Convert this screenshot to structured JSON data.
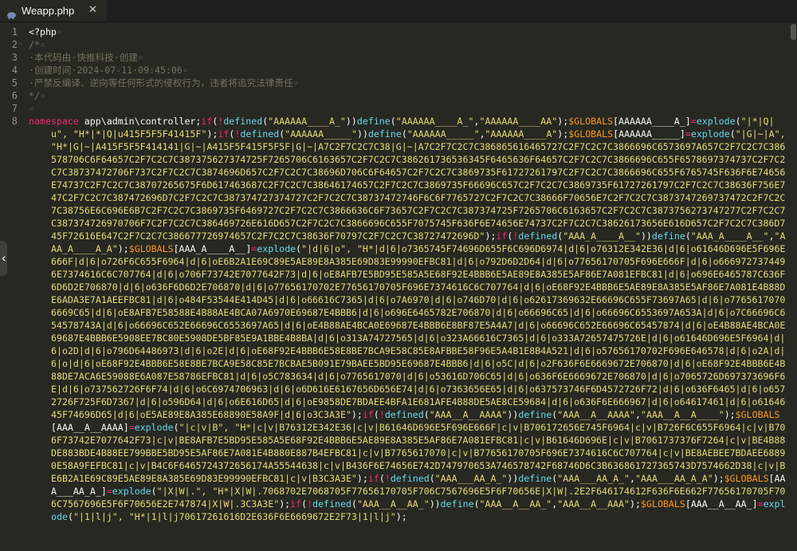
{
  "tab": {
    "title": "Weapp.php",
    "close": "✕",
    "icon": "elephant-icon"
  },
  "gutter": [
    {
      "n": "1",
      "fold": ""
    },
    {
      "n": "2",
      "fold": "-"
    },
    {
      "n": "3",
      "fold": ""
    },
    {
      "n": "4",
      "fold": ""
    },
    {
      "n": "5",
      "fold": ""
    },
    {
      "n": "6",
      "fold": ""
    },
    {
      "n": "7",
      "fold": ""
    },
    {
      "n": "8",
      "fold": ""
    }
  ],
  "code": {
    "l1": "<?php",
    "l2": "/*",
    "l3": "·本代码由·快推科技·创建",
    "l4": "·创建时间·2024-07-11·09:45:06",
    "l5": "·严禁反编译、逆向等任何形式的侵权行为，违者将追究法律责任",
    "l6": "*/",
    "l7": "",
    "l8": [
      [
        "kw",
        "namespace"
      ],
      [
        "ns",
        " app\\admin\\controller;"
      ],
      [
        "kw",
        "if"
      ],
      [
        "ns",
        "("
      ],
      [
        "op",
        "!"
      ],
      [
        "fn",
        "defined"
      ],
      [
        "ns",
        "("
      ],
      [
        "str",
        "\"AAAAAA____A_\""
      ],
      [
        "ns",
        "))"
      ],
      [
        "fn",
        "define"
      ],
      [
        "ns",
        "("
      ],
      [
        "str",
        "\"AAAAAA____A_\""
      ],
      [
        "ns",
        ","
      ],
      [
        "str",
        "\"AAAAAA____AA\""
      ],
      [
        "ns",
        ");"
      ],
      [
        "var",
        "$GLOBALS"
      ],
      [
        "ns",
        "[AAAAAA____A_]"
      ],
      [
        "op",
        "="
      ],
      [
        "fn",
        "explode"
      ],
      [
        "ns",
        "("
      ],
      [
        "str",
        "\"|*|Q|u\", \"H*|*|Q|u415F5F5F41415F\""
      ],
      [
        "ns",
        ");"
      ],
      [
        "kw",
        "if"
      ],
      [
        "ns",
        "("
      ],
      [
        "op",
        "!"
      ],
      [
        "fn",
        "defined"
      ],
      [
        "ns",
        "("
      ],
      [
        "str",
        "\"AAAAAA_____\""
      ],
      [
        "ns",
        "))"
      ],
      [
        "fn",
        "define"
      ],
      [
        "ns",
        "("
      ],
      [
        "str",
        "\"AAAAAA_____\""
      ],
      [
        "ns",
        ","
      ],
      [
        "str",
        "\"AAAAAA____A\""
      ],
      [
        "ns",
        ");"
      ],
      [
        "var",
        "$GLOBALS"
      ],
      [
        "ns",
        "[AAAAAA_____]"
      ],
      [
        "op",
        "="
      ],
      [
        "fn",
        "explode"
      ],
      [
        "ns",
        "("
      ],
      [
        "str",
        "\"|G|~|A\", \"H*|G|~|A415F5F5F414141|G|~|A415F5F415F5F5F|G|~|A7C2F7C2C7C38|G|~|A7C2F7C2C7C386865616465727C2F7C2C7C3866696C6573697A657C2F7C2C7C386578706C6F64657C2F7C2C7C387375627374725F7265706C6163657C2F7C2C7C386261736536345F6465636F64657C2F7C2C7C3866696C655F6578697374737C2F7C2C7C38737472706F737C2F7C2C7C3874696D657C2F7C2C7C38696D706C6F64657C2F7C2C7C3869735F61727261797C2F7C2C7C3866696C655F6765745F636F6E74656E74737C2F7C2C7C38707265675F6D617463687C2F7C2C7C38646174657C2F7C2C7C3869735F66696C657C2F7C2C7C3869735F61727261797C2F7C2C7C38636F756E747C2F7C2C7C387472696D7C2F7C2C7C387374727374727C2F7C2C7C38737472746F6C6F7765727C2F7C2C7C38666F70656E7C2F7C2C7C3873747269737472C2F7C2C7C38756E6C696E6B7C2F7C2C7C3869735F6469727C2F7C2C7C3866636C6F73657C2F7C2C7C387374725F7265706C6163657C2F7C2C7C3873756273747277C2F7C2C7C387374726970706F7C2F7C2C7C386469726E616D657C2F7C2C7C3866696C655F7075745F636F6E74656E74737C2F7C2C7C38626173656E616D657C2F7C2C7C386D745F72616E647C2F7C2C7C386677726974657C2F7C2C7C38636F70797C2F7C2C7C38727472696D\""
      ],
      [
        "ns",
        ");"
      ],
      [
        "kw",
        "if"
      ],
      [
        "ns",
        "("
      ],
      [
        "op",
        "!"
      ],
      [
        "fn",
        "defined"
      ],
      [
        "ns",
        "("
      ],
      [
        "str",
        "\"AAA_A____A__\""
      ],
      [
        "ns",
        "))"
      ],
      [
        "fn",
        "define"
      ],
      [
        "ns",
        "("
      ],
      [
        "str",
        "\"AAA_A____A__\""
      ],
      [
        "ns",
        ","
      ],
      [
        "str",
        "\"AAA_A____A_A\""
      ],
      [
        "ns",
        ");"
      ],
      [
        "var",
        "$GLOBALS"
      ],
      [
        "ns",
        "[AAA_A____A__]"
      ],
      [
        "op",
        "="
      ],
      [
        "fn",
        "explode"
      ],
      [
        "ns",
        "("
      ],
      [
        "str",
        "\"|d|6|o\", \"H*|d|6|o7365745F74696D655F6C696D6974|d|6|o76312E342E36|d|6|o61646D696E5F696E666F|d|6|o726F6C655F6964|d|6|oE6B2A1E69C89E5AE89E8A385E69D83E99990EFBC81|d|6|o792D6D2D64|d|6|o77656170705F696E666F|d|6|o6669727374496E7374616C6C707764|d|6|o706F73742E7077642F73|d|6|oE8AFB7E5BD95E585A5E68F92E4BBB6E5AE89E8A385E5AF86E7A081EFBC81|d|6|o696E6465787C636F6D6D2E706870|d|6|o636F6D6D2E706870|d|6|o77656170702E77656170705F696E7374616C6C707764|d|6|oE68F92E4BBB6E5AE89E8A385E5AF86E7A081E4B88DE6ADA3E7A1AEEFBC81|d|6|o484F53544E414D45|d|6|o66616C7365|d|6|o7A6970|d|6|o746D70|d|6|o62617369632E66696C655F73697A65|d|6|o77656170706669C65|d|6|oE8AFB7E58588E4B88AE4BCA07A6970E69687E4BBB6|d|6|o696E6465782E706870|d|6|o66696C65|d|6|o66696C6553697A653A|d|6|o7C66696C654578743A|d|6|o66696C652E66696C6553697A65|d|6|oE4B88AE4BCA0E69687E4BBB6E8BF87E5A4A7|d|6|o66696C652E66696C65457874|d|6|oE4B88AE4BCA0E69687E4BBB6E5908EE7BC80E5908DE5BF85E9A1BBE4B8BA|d|6|o313A74727565|d|6|o323A66616C7365|d|6|o333A72657475726E|d|6|o61646D696E5F6964|d|6|o2D|d|6|o796D64486973|d|6|o2E|d|6|oE68F92E4BBB6E58E8BE7BCA9E58C85E8AFBBE58F96E5A4B1E8B4A521|d|6|o57656170702F696E646578|d|6|o2A|d|6|o|d|6|oE68F92E4BBB6E58E8BE7BCA9E58C85E7BCBAE5B091E79BAEE5BD95E69687E4BBB6|d|6|o5C|d|6|o2F636F6E6669672E706870|d|6|oE68F92E4BBB6E4B88DE7ACA6E59088E6A087E58786EFBC81|d|6|o5C783634|d|6|o7765617070|d|6|o53616D706C65|d|6|o636F6E6669672E706870|d|6|o7065726D697373696F6E|d|6|o737562726F6F74|d|6|o6C6974706963|d|6|o6D616E6167656D656E74|d|6|o7363656E65|d|6|o637573746F6D4572726F72|d|6|o636F6465|d|6|o6572726F725F6D7367|d|6|o596D64|d|6|o6E616D65|d|6|oE9858DE7BDAEE4BFA1E681AFE4B88DE5AE8CE59684|d|6|o636F6E666967|d|6|o64617461|d|6|o6164645F74696D65|d|6|oE5AE89E8A385E68890E58A9F|d|6|o3C3A3E\""
      ],
      [
        "ns",
        ");"
      ],
      [
        "kw",
        "if"
      ],
      [
        "ns",
        "("
      ],
      [
        "op",
        "!"
      ],
      [
        "fn",
        "defined"
      ],
      [
        "ns",
        "("
      ],
      [
        "str",
        "\"AAA__A__AAAA\""
      ],
      [
        "ns",
        "))"
      ],
      [
        "fn",
        "define"
      ],
      [
        "ns",
        "("
      ],
      [
        "str",
        "\"AAA__A__AAAA\""
      ],
      [
        "ns",
        ","
      ],
      [
        "str",
        "\"AAA__A__A____\""
      ],
      [
        "ns",
        ");"
      ],
      [
        "var",
        "$GLOBALS"
      ],
      [
        "ns",
        "[AAA__A__AAAA]"
      ],
      [
        "op",
        "="
      ],
      [
        "fn",
        "explode"
      ],
      [
        "ns",
        "("
      ],
      [
        "str",
        "\"|c|v|B\", \"H*|c|v|B76312E342E36|c|v|B61646D696E5F696E666F|c|v|B706172656E745F6964|c|v|B726F6C655F6964|c|v|B706F73742E7077642F73|c|v|BE8AFB7E5BD95E585A5E68F92E4BBB6E5AE89E8A385E5AF86E7A081EFBC81|c|v|B61646D696E|c|v|B7061737376F7264|c|v|BE4B88DE883BDE4B88EE799BBE5BD95E5AF86E7A081E4B880E887B4EFBC81|c|v|B7765617070|c|v|B77656170705F696E7374616C6C707764|c|v|BE8AEBEE7BDAEE68890E58A9FEFBC81|c|v|B4C6F6465724372656174A55544638|c|v|B436F6E74656E742D747970653A746578742F68746D6C3B636861727365743D7574662D38|c|v|BE6B2A1E69C89E5AE89E8A385E69D83E99990EFBC81|c|v|B3C3A3E\""
      ],
      [
        "ns",
        ");"
      ],
      [
        "kw",
        "if"
      ],
      [
        "ns",
        "("
      ],
      [
        "op",
        "!"
      ],
      [
        "fn",
        "defined"
      ],
      [
        "ns",
        "("
      ],
      [
        "str",
        "\"AAA___AA_A_\""
      ],
      [
        "ns",
        "))"
      ],
      [
        "fn",
        "define"
      ],
      [
        "ns",
        "("
      ],
      [
        "str",
        "\"AAA___AA_A_\""
      ],
      [
        "ns",
        ","
      ],
      [
        "str",
        "\"AAA___AA_A_A\""
      ],
      [
        "ns",
        ");"
      ],
      [
        "var",
        "$GLOBALS"
      ],
      [
        "ns",
        "[AAA___AA_A_]"
      ],
      [
        "op",
        "="
      ],
      [
        "fn",
        "explode"
      ],
      [
        "ns",
        "("
      ],
      [
        "str",
        "\"|X|W|.\", \"H*|X|W|.7068702E7068705F77656170705F706C7567696E5F6F70656E|X|W|.2E2F646174612F636F6E662F77656170705F706C7567696E5F6F70656E2E747874|X|W|.3C3A3E\""
      ],
      [
        "ns",
        ");"
      ],
      [
        "kw",
        "if"
      ],
      [
        "ns",
        "("
      ],
      [
        "op",
        "!"
      ],
      [
        "fn",
        "defined"
      ],
      [
        "ns",
        "("
      ],
      [
        "str",
        "\"AAA__A__AA_\""
      ],
      [
        "ns",
        "))"
      ],
      [
        "fn",
        "define"
      ],
      [
        "ns",
        "("
      ],
      [
        "str",
        "\"AAA__A__AA_\""
      ],
      [
        "ns",
        ","
      ],
      [
        "str",
        "\"AAA__A__AAA\""
      ],
      [
        "ns",
        ");"
      ],
      [
        "var",
        "$GLOBALS"
      ],
      [
        "ns",
        "[AAA__A__AA_]"
      ],
      [
        "op",
        "="
      ],
      [
        "fn",
        "explode"
      ],
      [
        "ns",
        "("
      ],
      [
        "str",
        "\"|1|l|j\", \"H*|1|l|j70617261616D2E636F6E6669672E2F73|1|l|j\""
      ],
      [
        "ns",
        ");"
      ]
    ]
  },
  "colors": {
    "background": "#272822",
    "keyword": "#f92672",
    "function": "#66d9ef",
    "string": "#e6db74",
    "variable": "#fd971f",
    "comment": "#75715e"
  }
}
